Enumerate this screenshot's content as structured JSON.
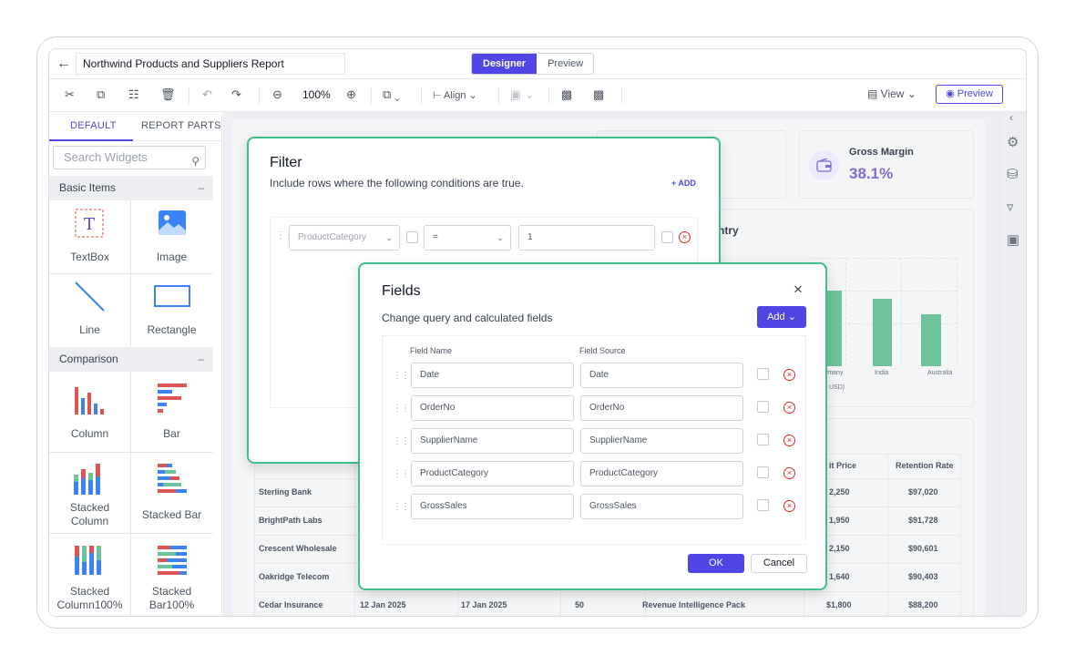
{
  "header": {
    "back_icon": "arrow-left-icon",
    "report_title": "Northwind Products and Suppliers Report",
    "mode_designer": "Designer",
    "mode_preview": "Preview"
  },
  "toolbar": {
    "zoom": "100%",
    "align": "Align",
    "view": "View",
    "preview": "Preview"
  },
  "left_panel": {
    "tabs": [
      "DEFAULT",
      "REPORT PARTS"
    ],
    "search_placeholder": "Search Widgets",
    "sections": [
      {
        "title": "Basic Items",
        "items": [
          "TextBox",
          "Image",
          "Line",
          "Rectangle"
        ]
      },
      {
        "title": "Comparison",
        "items": [
          "Column",
          "Bar",
          "Stacked\nColumn",
          "Stacked Bar",
          "Stacked\nColumn100%",
          "Stacked\nBar100%"
        ]
      }
    ]
  },
  "canvas": {
    "kpi": {
      "title": "Gross Margin",
      "value": "38.1%"
    },
    "chart_title_fragment": "ntry",
    "chart_labels": [
      "rmany",
      "India",
      "Australia"
    ],
    "chart_unit_fragment": "USD)",
    "table": {
      "headers": [
        "it Price",
        "Retention Rate"
      ],
      "rows": [
        [
          "Sterling Bank",
          "",
          "",
          "",
          "",
          "2,250",
          "$97,020"
        ],
        [
          "BrightPath Labs",
          "",
          "",
          "",
          "",
          "1,950",
          "$91,728"
        ],
        [
          "Crescent Wholesale",
          "",
          "",
          "",
          "",
          "2,150",
          "$90,601"
        ],
        [
          "Oakridge Telecom",
          "",
          "",
          "",
          "",
          "1,640",
          "$90,403"
        ],
        [
          "Cedar Insurance",
          "12 Jan 2025",
          "17 Jan 2025",
          "50",
          "Revenue Intelligence Pack",
          "$1,800",
          "$88,200"
        ]
      ]
    }
  },
  "filter_dialog": {
    "title": "Filter",
    "subtitle": "Include rows where the following conditions are true.",
    "add": "+ ADD",
    "condition": {
      "field": "ProductCategory",
      "operator": "=",
      "value": "1"
    }
  },
  "fields_dialog": {
    "title": "Fields",
    "subtitle": "Change query and calculated fields",
    "add_button": "Add",
    "col_name": "Field Name",
    "col_source": "Field Source",
    "rows": [
      {
        "name": "Date",
        "source": "Date"
      },
      {
        "name": "OrderNo",
        "source": "OrderNo"
      },
      {
        "name": "SupplierName",
        "source": "SupplierName"
      },
      {
        "name": "ProductCategory",
        "source": "ProductCategory"
      },
      {
        "name": "GrossSales",
        "source": "GrossSales"
      }
    ],
    "ok": "OK",
    "cancel": "Cancel"
  },
  "colors": {
    "accent": "#4f46e5",
    "dialog_border": "#3fbf8a",
    "bar": "#6ec49a",
    "danger": "#dc2626"
  }
}
